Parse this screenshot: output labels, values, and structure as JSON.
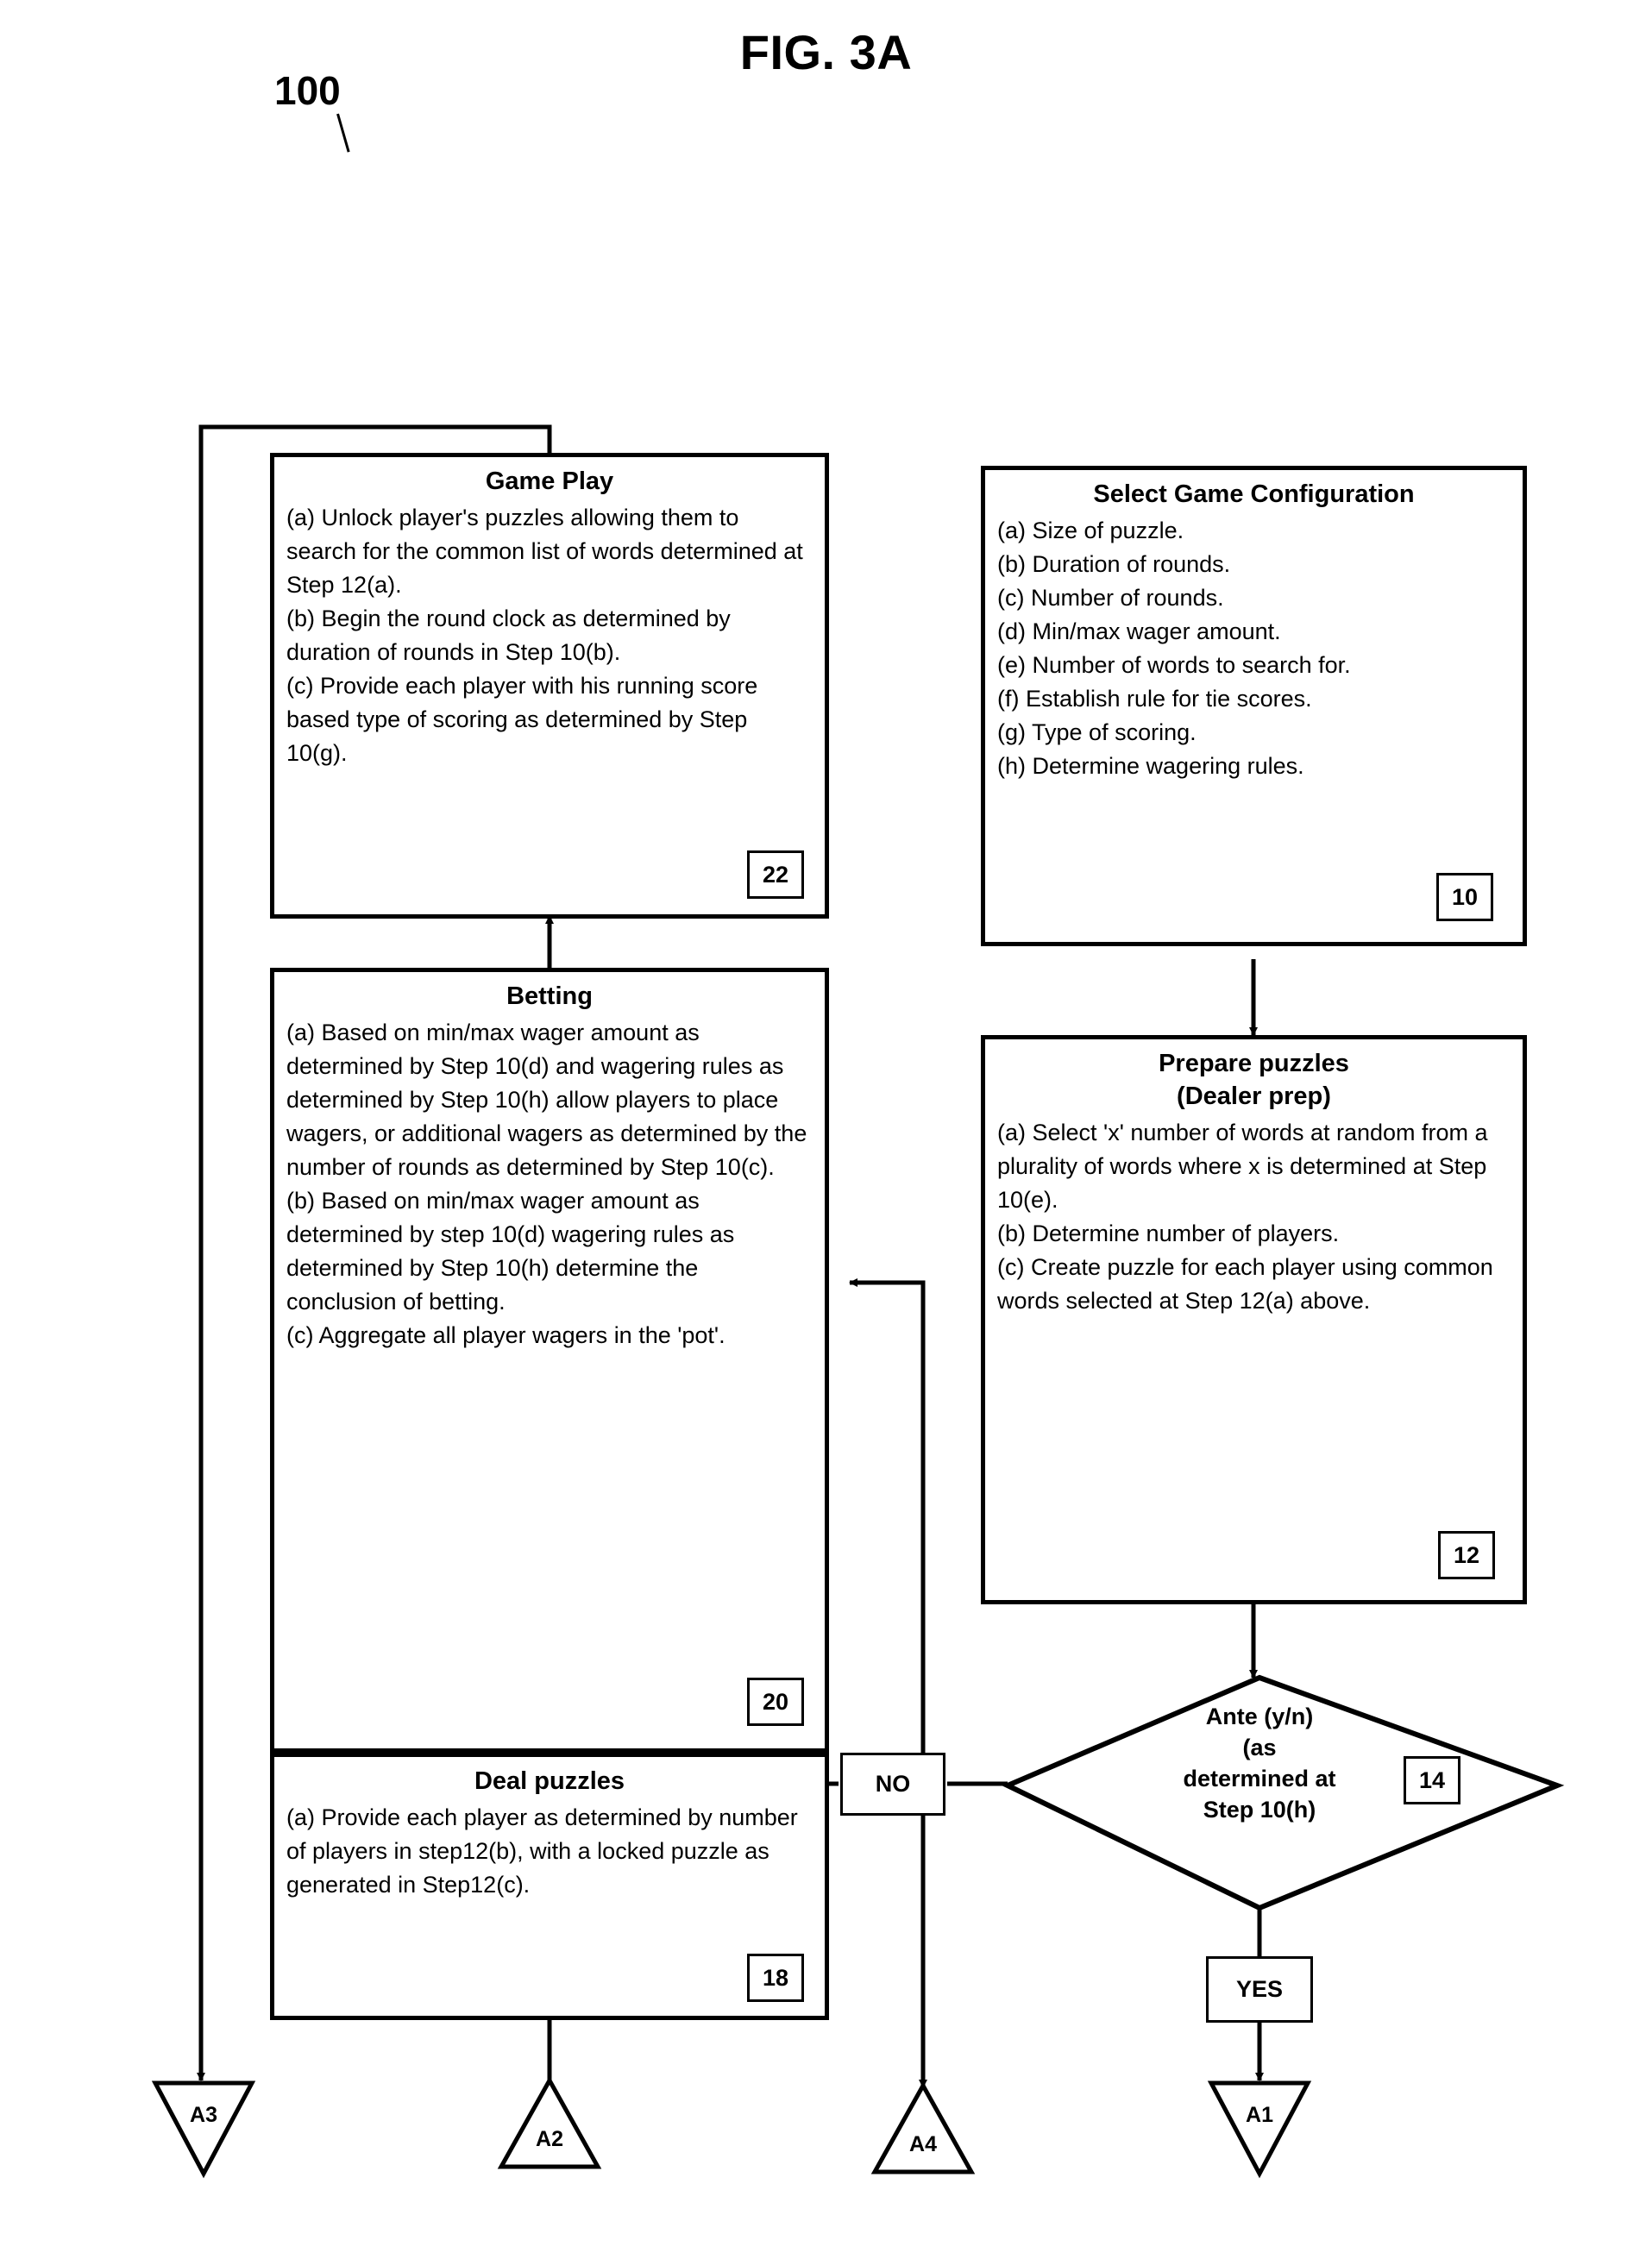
{
  "figure": {
    "title": "FIG. 3A",
    "reference_number": "100"
  },
  "nodes": {
    "game_play": {
      "title": "Game Play",
      "items": [
        "(a) Unlock player's puzzles allowing them to search for the common list of words determined at Step 12(a).",
        "(b) Begin the round clock as determined by duration of rounds in Step 10(b).",
        "(c) Provide each player with his running score based type of scoring as determined by Step 10(g)."
      ],
      "ref": "22"
    },
    "select_game_configuration": {
      "title": "Select Game Configuration",
      "items": [
        "(a) Size of puzzle.",
        "(b) Duration of rounds.",
        "(c) Number of rounds.",
        "(d) Min/max wager amount.",
        "(e) Number of words to search for.",
        "(f) Establish rule for tie scores.",
        "(g) Type of scoring.",
        "(h) Determine wagering rules."
      ],
      "ref": "10"
    },
    "betting": {
      "title": "Betting",
      "items": [
        "(a) Based on min/max wager amount as determined by Step 10(d) and wagering rules as determined by Step 10(h) allow players to place wagers, or additional wagers as determined by the number of rounds as determined by Step 10(c).",
        "(b) Based on min/max wager amount as determined by step 10(d) wagering rules as determined by Step 10(h) determine the conclusion of betting.",
        "(c) Aggregate all player wagers in the 'pot'."
      ],
      "ref": "20"
    },
    "prepare_puzzles": {
      "title": "Prepare puzzles",
      "subtitle": "(Dealer prep)",
      "items": [
        "(a) Select 'x' number of words at random from a plurality of words where x is determined at Step 10(e).",
        "(b) Determine number of players.",
        "(c) Create puzzle for each player using common words selected at Step 12(a) above."
      ],
      "ref": "12"
    },
    "deal_puzzles": {
      "title": "Deal puzzles",
      "items": [
        "(a) Provide each player as determined by number of players in step12(b), with a locked puzzle as generated in Step12(c)."
      ],
      "ref": "18"
    },
    "ante_decision": {
      "lines": [
        "Ante (y/n)",
        "(as",
        "determined at",
        "Step 10(h)"
      ],
      "ref": "14"
    }
  },
  "labels": {
    "no": "NO",
    "yes": "YES"
  },
  "connectors": [
    {
      "id": "a3",
      "label": "A3",
      "direction": "down"
    },
    {
      "id": "a2",
      "label": "A2",
      "direction": "up"
    },
    {
      "id": "a4",
      "label": "A4",
      "direction": "up"
    },
    {
      "id": "a1",
      "label": "A1",
      "direction": "down"
    }
  ],
  "colors": {
    "ink": "#000000",
    "paper": "#ffffff"
  }
}
